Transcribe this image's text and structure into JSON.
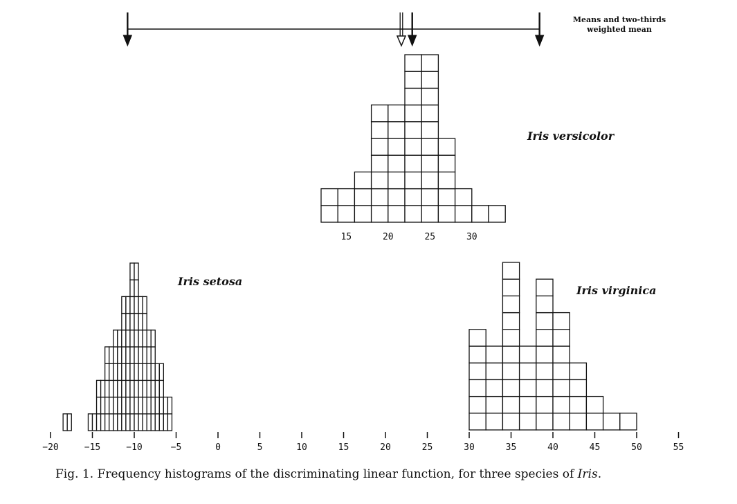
{
  "chart_data": {
    "type": "histogram",
    "x_axis": {
      "ticks": [
        -20,
        -15,
        -10,
        -5,
        0,
        5,
        10,
        15,
        20,
        25,
        30,
        35,
        40,
        45,
        50,
        55
      ],
      "range": [
        -20,
        55
      ]
    },
    "y_unit": "one box = one specimen",
    "series": [
      {
        "name": "Iris setosa",
        "bin_width": 1,
        "bins": [
          {
            "x": -18,
            "count": 1
          },
          {
            "x": -15,
            "count": 1
          },
          {
            "x": -14,
            "count": 3
          },
          {
            "x": -13,
            "count": 5
          },
          {
            "x": -12,
            "count": 6
          },
          {
            "x": -11,
            "count": 8
          },
          {
            "x": -10,
            "count": 10
          },
          {
            "x": -9,
            "count": 8
          },
          {
            "x": -8,
            "count": 6
          },
          {
            "x": -7,
            "count": 4
          },
          {
            "x": -6,
            "count": 2
          }
        ]
      },
      {
        "name": "Iris versicolor",
        "bin_width": 2,
        "axis_ticks": [
          15,
          20,
          25,
          30
        ],
        "bins": [
          {
            "x": 13,
            "count": 2
          },
          {
            "x": 15,
            "count": 2
          },
          {
            "x": 17,
            "count": 3
          },
          {
            "x": 19,
            "count": 7
          },
          {
            "x": 21,
            "count": 7
          },
          {
            "x": 23,
            "count": 10
          },
          {
            "x": 25,
            "count": 10
          },
          {
            "x": 27,
            "count": 5
          },
          {
            "x": 29,
            "count": 2
          },
          {
            "x": 31,
            "count": 1
          },
          {
            "x": 33,
            "count": 1
          }
        ]
      },
      {
        "name": "Iris virginica",
        "bin_width": 2,
        "bins": [
          {
            "x": 31,
            "count": 6
          },
          {
            "x": 33,
            "count": 5
          },
          {
            "x": 35,
            "count": 10
          },
          {
            "x": 37,
            "count": 5
          },
          {
            "x": 39,
            "count": 9
          },
          {
            "x": 41,
            "count": 7
          },
          {
            "x": 43,
            "count": 4
          },
          {
            "x": 45,
            "count": 2
          },
          {
            "x": 47,
            "count": 1
          },
          {
            "x": 49,
            "count": 1
          }
        ]
      }
    ],
    "markers": [
      {
        "label": "mean setosa",
        "x": -10.8
      },
      {
        "label": "two-thirds weighted mean",
        "x": 21.9
      },
      {
        "label": "mean versicolor",
        "x": 23.2
      },
      {
        "label": "mean virginica",
        "x": 38.4
      }
    ],
    "annotation": "Means and two-thirds weighted mean",
    "labels": {
      "setosa": "Iris setosa",
      "versicolor": "Iris versicolor",
      "virginica": "Iris virginica"
    }
  },
  "legend_note": {
    "line1": "Means and two-thirds",
    "line2": "weighted mean"
  },
  "caption": {
    "prefix": "Fig. 1.  Frequency histograms of the discriminating linear function, for three species of ",
    "emph": "Iris",
    "suffix": "."
  }
}
